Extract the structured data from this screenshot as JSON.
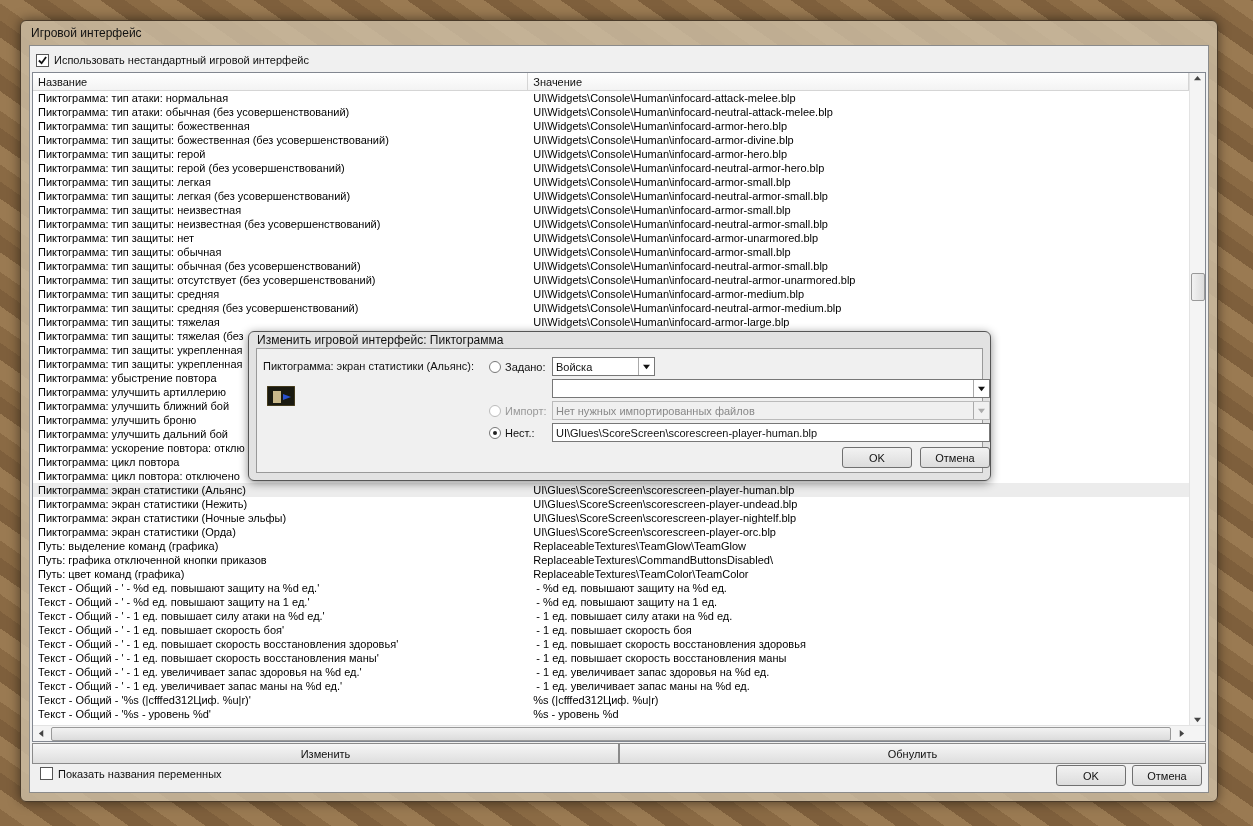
{
  "window": {
    "title": "Игровой интерфейс"
  },
  "use_custom": {
    "label": "Использовать нестандартный игровой интерфейс",
    "checked": true
  },
  "table": {
    "columns": [
      "Название",
      "Значение"
    ],
    "rows": [
      {
        "name": "Пиктограмма: тип атаки: нормальная",
        "value": "UI\\Widgets\\Console\\Human\\infocard-attack-melee.blp",
        "selected": false
      },
      {
        "name": "Пиктограмма: тип атаки: обычная (без усовершенствований)",
        "value": "UI\\Widgets\\Console\\Human\\infocard-neutral-attack-melee.blp",
        "selected": false
      },
      {
        "name": "Пиктограмма: тип защиты: божественная",
        "value": "UI\\Widgets\\Console\\Human\\infocard-armor-hero.blp",
        "selected": false
      },
      {
        "name": "Пиктограмма: тип защиты: божественная (без усовершенствований)",
        "value": "UI\\Widgets\\Console\\Human\\infocard-armor-divine.blp",
        "selected": false
      },
      {
        "name": "Пиктограмма: тип защиты: герой",
        "value": "UI\\Widgets\\Console\\Human\\infocard-armor-hero.blp",
        "selected": false
      },
      {
        "name": "Пиктограмма: тип защиты: герой (без усовершенствований)",
        "value": "UI\\Widgets\\Console\\Human\\infocard-neutral-armor-hero.blp",
        "selected": false
      },
      {
        "name": "Пиктограмма: тип защиты: легкая",
        "value": "UI\\Widgets\\Console\\Human\\infocard-armor-small.blp",
        "selected": false
      },
      {
        "name": "Пиктограмма: тип защиты: легкая (без усовершенствований)",
        "value": "UI\\Widgets\\Console\\Human\\infocard-neutral-armor-small.blp",
        "selected": false
      },
      {
        "name": "Пиктограмма: тип защиты: неизвестная",
        "value": "UI\\Widgets\\Console\\Human\\infocard-armor-small.blp",
        "selected": false
      },
      {
        "name": "Пиктограмма: тип защиты: неизвестная (без усовершенствований)",
        "value": "UI\\Widgets\\Console\\Human\\infocard-neutral-armor-small.blp",
        "selected": false
      },
      {
        "name": "Пиктограмма: тип защиты: нет",
        "value": "UI\\Widgets\\Console\\Human\\infocard-armor-unarmored.blp",
        "selected": false
      },
      {
        "name": "Пиктограмма: тип защиты: обычная",
        "value": "UI\\Widgets\\Console\\Human\\infocard-armor-small.blp",
        "selected": false
      },
      {
        "name": "Пиктограмма: тип защиты: обычная (без усовершенствований)",
        "value": "UI\\Widgets\\Console\\Human\\infocard-neutral-armor-small.blp",
        "selected": false
      },
      {
        "name": "Пиктограмма: тип защиты: отсутствует (без усовершенствований)",
        "value": "UI\\Widgets\\Console\\Human\\infocard-neutral-armor-unarmored.blp",
        "selected": false
      },
      {
        "name": "Пиктограмма: тип защиты: средняя",
        "value": "UI\\Widgets\\Console\\Human\\infocard-armor-medium.blp",
        "selected": false
      },
      {
        "name": "Пиктограмма: тип защиты: средняя (без усовершенствований)",
        "value": "UI\\Widgets\\Console\\Human\\infocard-neutral-armor-medium.blp",
        "selected": false
      },
      {
        "name": "Пиктограмма: тип защиты: тяжелая",
        "value": "UI\\Widgets\\Console\\Human\\infocard-armor-large.blp",
        "selected": false
      },
      {
        "name": "Пиктограмма: тип защиты: тяжелая (без",
        "selected": false
      },
      {
        "name": "Пиктограмма: тип защиты: укрепленная",
        "selected": false
      },
      {
        "name": "Пиктограмма: тип защиты: укрепленная",
        "selected": false
      },
      {
        "name": "Пиктограмма: убыстрение повтора",
        "selected": false
      },
      {
        "name": "Пиктограмма: улучшить артиллерию",
        "selected": false
      },
      {
        "name": "Пиктограмма: улучшить ближний бой",
        "selected": false
      },
      {
        "name": "Пиктограмма: улучшить броню",
        "selected": false
      },
      {
        "name": "Пиктограмма: улучшить дальний бой",
        "selected": false
      },
      {
        "name": "Пиктограмма: ускорение повтора: отклю",
        "selected": false
      },
      {
        "name": "Пиктограмма: цикл повтора",
        "selected": false
      },
      {
        "name": "Пиктограмма: цикл повтора: отключено",
        "selected": false
      },
      {
        "name": "Пиктограмма: экран статистики (Альянс)",
        "value": "UI\\Glues\\ScoreScreen\\scorescreen-player-human.blp",
        "selected": true
      },
      {
        "name": "Пиктограмма: экран статистики (Нежить)",
        "value": "UI\\Glues\\ScoreScreen\\scorescreen-player-undead.blp",
        "selected": false
      },
      {
        "name": "Пиктограмма: экран статистики (Ночные эльфы)",
        "value": "UI\\Glues\\ScoreScreen\\scorescreen-player-nightelf.blp",
        "selected": false
      },
      {
        "name": "Пиктограмма: экран статистики (Орда)",
        "value": "UI\\Glues\\ScoreScreen\\scorescreen-player-orc.blp",
        "selected": false
      },
      {
        "name": "Путь: выделение команд (графика)",
        "value": "ReplaceableTextures\\TeamGlow\\TeamGlow",
        "selected": false
      },
      {
        "name": "Путь: графика отключенной кнопки приказов",
        "value": "ReplaceableTextures\\CommandButtonsDisabled\\",
        "selected": false
      },
      {
        "name": "Путь: цвет команд (графика)",
        "value": "ReplaceableTextures\\TeamColor\\TeamColor",
        "selected": false
      },
      {
        "name": "Текст - Общий - ' - %d ед. повышают защиту на %d ед.'",
        "value": " - %d ед. повышают защиту на %d ед.",
        "selected": false
      },
      {
        "name": "Текст - Общий - ' - %d ед. повышают защиту на 1 ед.'",
        "value": " - %d ед. повышают защиту на 1 ед.",
        "selected": false
      },
      {
        "name": "Текст - Общий - ' - 1 ед. повышает силу атаки на %d ед.'",
        "value": " - 1 ед. повышает силу атаки на %d ед.",
        "selected": false
      },
      {
        "name": "Текст - Общий - ' - 1 ед. повышает скорость боя'",
        "value": " - 1 ед. повышает скорость боя",
        "selected": false
      },
      {
        "name": "Текст - Общий - ' - 1 ед. повышает скорость восстановления здоровья'",
        "value": " - 1 ед. повышает скорость восстановления здоровья",
        "selected": false
      },
      {
        "name": "Текст - Общий - ' - 1 ед. повышает скорость восстановления маны'",
        "value": " - 1 ед. повышает скорость восстановления маны",
        "selected": false
      },
      {
        "name": "Текст - Общий - ' - 1 ед. увеличивает запас здоровья на %d ед.'",
        "value": " - 1 ед. увеличивает запас здоровья на %d ед.",
        "selected": false
      },
      {
        "name": "Текст - Общий - ' - 1 ед. увеличивает запас маны на %d ед.'",
        "value": " - 1 ед. увеличивает запас маны на %d ед.",
        "selected": false
      },
      {
        "name": "Текст - Общий - '%s (|cfffed312Циф. %u|r)'",
        "value": "%s (|cfffed312Циф. %u|r)",
        "selected": false
      },
      {
        "name": "Текст - Общий - '%s - уровень %d'",
        "value": "%s - уровень %d",
        "selected": false
      }
    ]
  },
  "actions": [
    "Изменить",
    "Обнулить"
  ],
  "show_var_names": {
    "label": "Показать названия переменных",
    "checked": false
  },
  "buttons": [
    "OK",
    "Отмена"
  ],
  "dialog": {
    "title": "Изменить игровой интерфейс: Пиктограмма",
    "label": "Пиктограмма: экран статистики (Альянс):",
    "options": [
      {
        "kind": "preset",
        "label": "Задано:",
        "selected": false,
        "disabled": false,
        "value": "Войска"
      },
      {
        "kind": "import",
        "label": "Импорт:",
        "selected": false,
        "disabled": true,
        "value": "Нет нужных импортированных файлов"
      },
      {
        "kind": "custom",
        "label": "Нест.:",
        "selected": true,
        "disabled": false,
        "value": "UI\\Glues\\ScoreScreen\\scorescreen-player-human.blp"
      }
    ],
    "buttons": [
      "OK",
      "Отмена"
    ]
  }
}
